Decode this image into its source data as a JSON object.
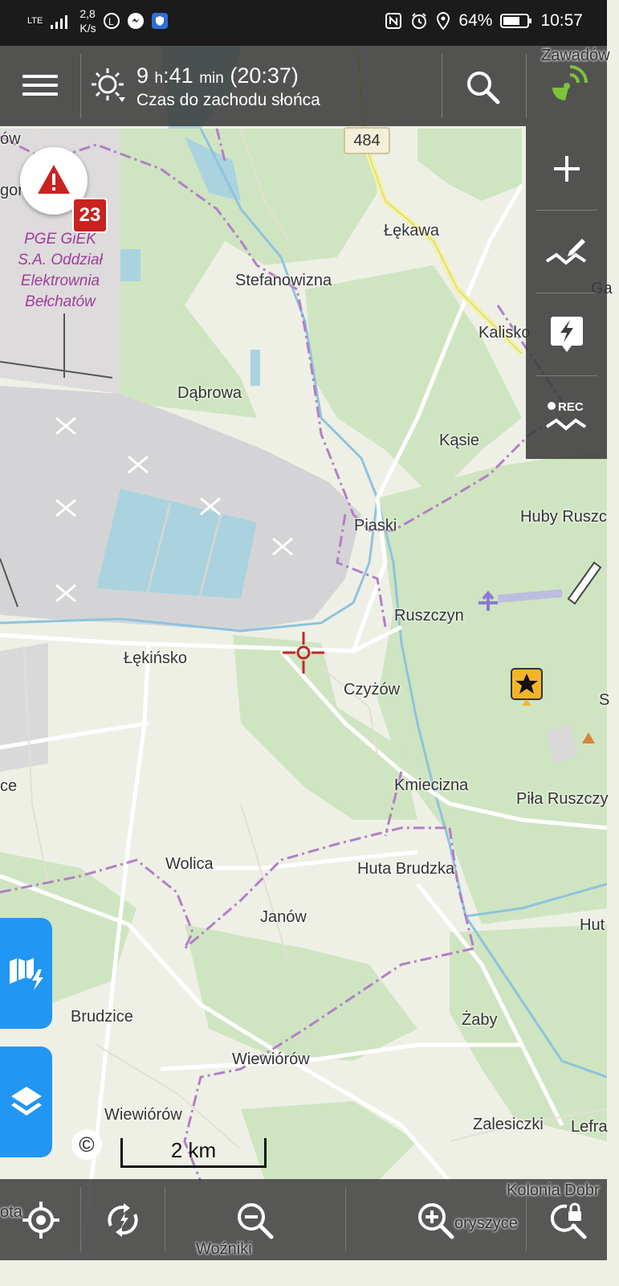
{
  "status_bar": {
    "network": "LTE",
    "speed_value": "2,8",
    "speed_unit": "K/s",
    "battery": "64%",
    "time": "10:57"
  },
  "top_bar": {
    "sun_hours": "9",
    "sun_hours_unit": "h",
    "sun_minutes": ":41",
    "sun_minutes_unit": "min",
    "sunset_time": "(20:37)",
    "sun_label": "Czas do zachodu słońca"
  },
  "warnings": {
    "count": "23"
  },
  "map": {
    "road_number": "484",
    "poi": [
      "PGE GiEK",
      "S.A. Oddział",
      "Elektrownia",
      "Bełchatów"
    ],
    "places": [
      {
        "id": "zawadow",
        "text": "Zawadów"
      },
      {
        "id": "ow",
        "text": "ów"
      },
      {
        "id": "gor",
        "text": "gor"
      },
      {
        "id": "lekawa",
        "text": "Łękawa"
      },
      {
        "id": "stefanowizna",
        "text": "Stefanowizna"
      },
      {
        "id": "ga",
        "text": "Ga"
      },
      {
        "id": "kalisko",
        "text": "Kalisko"
      },
      {
        "id": "dabrowa",
        "text": "Dąbrowa"
      },
      {
        "id": "kasie",
        "text": "Kąsie"
      },
      {
        "id": "piaski",
        "text": "Piaski"
      },
      {
        "id": "huby",
        "text": "Huby Ruszc"
      },
      {
        "id": "ruszczyn",
        "text": "Ruszczyn"
      },
      {
        "id": "lekinsko",
        "text": "Łękińsko"
      },
      {
        "id": "czyzow",
        "text": "Czyżów"
      },
      {
        "id": "s",
        "text": "S"
      },
      {
        "id": "ce",
        "text": "ce"
      },
      {
        "id": "kmiecizna",
        "text": "Kmiecizna"
      },
      {
        "id": "pila",
        "text": "Piła Ruszczy"
      },
      {
        "id": "wolica",
        "text": "Wolica"
      },
      {
        "id": "hutabrudzka",
        "text": "Huta Brudzka"
      },
      {
        "id": "janow",
        "text": "Janów"
      },
      {
        "id": "hut",
        "text": "Hut"
      },
      {
        "id": "brudzice",
        "text": "Brudzice"
      },
      {
        "id": "zaby",
        "text": "Żaby"
      },
      {
        "id": "wiewiorow1",
        "text": "Wiewiórów"
      },
      {
        "id": "wiewiorow2",
        "text": "Wiewiórów"
      },
      {
        "id": "zalesiczki",
        "text": "Zalesiczki"
      },
      {
        "id": "lefra",
        "text": "Lefra"
      },
      {
        "id": "kolonia",
        "text": "Kolonia Dobr"
      },
      {
        "id": "oryszyce",
        "text": "oryszyce"
      },
      {
        "id": "ota",
        "text": "ota"
      },
      {
        "id": "wozniki",
        "text": "Woźniki"
      }
    ]
  },
  "scale": {
    "label": "2 km"
  },
  "copyright_symbol": "©",
  "icons": {
    "menu": "hamburger-icon",
    "sun": "sunset-icon",
    "search": "search-icon",
    "gps": "gps-satellite-icon",
    "zoom_plus": "plus-icon",
    "route_planner": "route-planner-icon",
    "quick_action": "lightning-bubble-icon",
    "record": "rec-track-icon",
    "warning": "warning-triangle-icon",
    "map_lightning": "map-lightning-icon",
    "layers": "layers-icon",
    "my_location": "my-location-icon",
    "rotate": "rotate-map-icon",
    "zoom_out": "zoom-out-icon",
    "zoom_in": "zoom-in-icon",
    "lock": "lock-zoom-icon"
  },
  "colors": {
    "bar_bg": "#3c3c3c",
    "accent_blue": "#2196f3",
    "gps_green": "#7cc33a",
    "warning_red": "#c8231f",
    "boundary_purple": "#b27fc6",
    "forest_green": "#cde5c0",
    "mine_gray": "#d4d4d6",
    "water_blue": "#aad3df"
  }
}
